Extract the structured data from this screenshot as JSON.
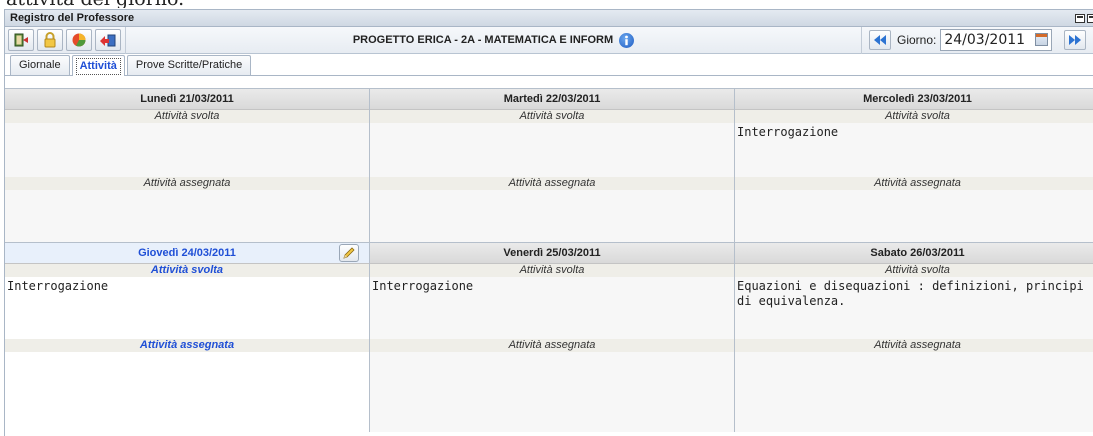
{
  "heading_fragment": "attività del giorno.",
  "window": {
    "title": "Registro del Professore"
  },
  "toolbar": {
    "icons": [
      "exit-icon",
      "lock-icon",
      "pie-chart-icon",
      "send-icon"
    ],
    "course_title": "PROGETTO ERICA - 2A - MATEMATICA E INFORM",
    "giorno_label": "Giorno:",
    "date_value": "24/03/2011"
  },
  "tabs": [
    {
      "label": "Giornale"
    },
    {
      "label": "Attività",
      "active": true
    },
    {
      "label": "Prove Scritte/Pratiche"
    }
  ],
  "labels": {
    "svolta": "Attività svolta",
    "assegnata": "Attività assegnata"
  },
  "days": [
    {
      "title": "Lunedì 21/03/2011",
      "svolta": "",
      "assegnata": ""
    },
    {
      "title": "Martedì 22/03/2011",
      "svolta": "",
      "assegnata": ""
    },
    {
      "title": "Mercoledì 23/03/2011",
      "svolta": "Interrogazione",
      "assegnata": ""
    },
    {
      "title": "Giovedì 24/03/2011",
      "svolta": "Interrogazione",
      "assegnata": "",
      "today": true
    },
    {
      "title": "Venerdì 25/03/2011",
      "svolta": "Interrogazione",
      "assegnata": ""
    },
    {
      "title": "Sabato 26/03/2011",
      "svolta": "Equazioni e disequazioni : definizioni, principi di equivalenza.",
      "assegnata": ""
    }
  ],
  "colors": {
    "accent_blue": "#1f4fd6",
    "header_gray": "#d9d9d9",
    "section_band": "#efeee8"
  }
}
